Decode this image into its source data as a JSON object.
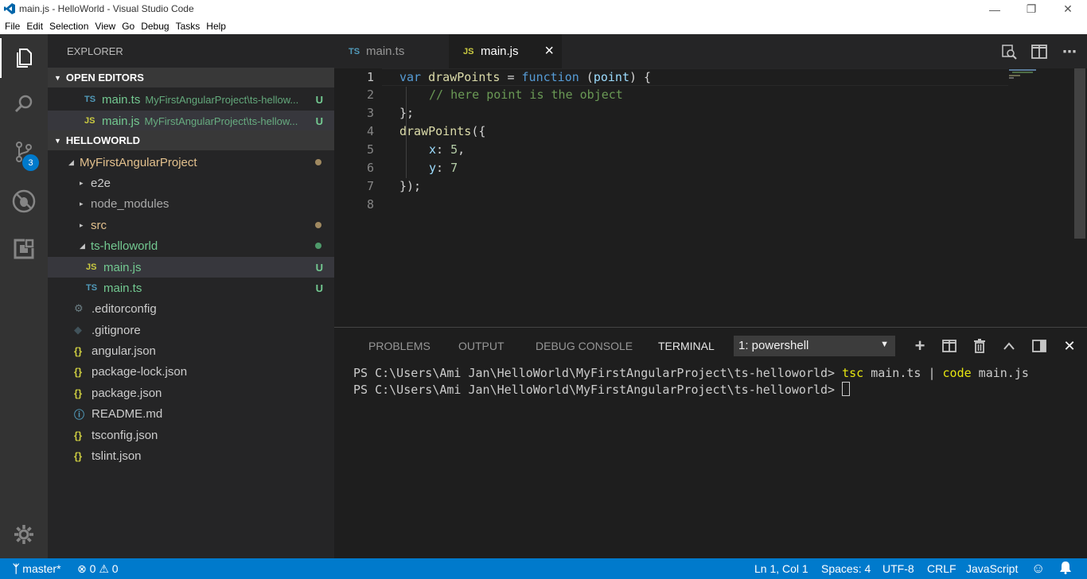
{
  "window": {
    "title": "main.js - HelloWorld - Visual Studio Code"
  },
  "menu": [
    "File",
    "Edit",
    "Selection",
    "View",
    "Go",
    "Debug",
    "Tasks",
    "Help"
  ],
  "activity": {
    "scm_badge": "3"
  },
  "sidebar": {
    "title": "EXPLORER",
    "open_editors": {
      "header": "OPEN EDITORS",
      "items": [
        {
          "icon": "TS",
          "name": "main.ts",
          "desc": "MyFirstAngularProject\\ts-hellow...",
          "status": "U"
        },
        {
          "icon": "JS",
          "name": "main.js",
          "desc": "MyFirstAngularProject\\ts-hellow...",
          "status": "U"
        }
      ]
    },
    "workspace": {
      "header": "HELLOWORLD",
      "project": "MyFirstAngularProject",
      "folders": [
        "e2e",
        "node_modules",
        "src",
        "ts-helloworld"
      ],
      "ts_helloworld_files": [
        {
          "icon": "JS",
          "name": "main.js",
          "status": "U"
        },
        {
          "icon": "TS",
          "name": "main.ts",
          "status": "U"
        }
      ],
      "root_files": [
        ".editorconfig",
        ".gitignore",
        "angular.json",
        "package-lock.json",
        "package.json",
        "README.md",
        "tsconfig.json",
        "tslint.json"
      ]
    }
  },
  "tabs": [
    {
      "icon": "TS",
      "label": "main.ts"
    },
    {
      "icon": "JS",
      "label": "main.js",
      "close": "×"
    }
  ],
  "editor": {
    "line_numbers": [
      "1",
      "2",
      "3",
      "4",
      "5",
      "6",
      "7",
      "8"
    ],
    "l1": {
      "kw": "var",
      "name": "drawPoints",
      "eq": " = ",
      "fn": "function",
      "open": " (",
      "param": "point",
      "close": ") {"
    },
    "l2": "// here point is the object",
    "l3": "};",
    "l4": {
      "fn": "drawPoints",
      "rest": "({"
    },
    "l5": {
      "key": "x",
      "colon": ": ",
      "num": "5",
      "end": ","
    },
    "l6": {
      "key": "y",
      "colon": ": ",
      "num": "7"
    },
    "l7": "});"
  },
  "panel": {
    "tabs": [
      "PROBLEMS",
      "OUTPUT",
      "DEBUG CONSOLE",
      "TERMINAL"
    ],
    "terminal_select": "1: powershell",
    "terminal_lines": {
      "l1_prompt": "PS C:\\Users\\Ami Jan\\HelloWorld\\MyFirstAngularProject\\ts-helloworld> ",
      "l1_cmd1": "tsc",
      "l1_arg1": " main.ts | ",
      "l1_cmd2": "code",
      "l1_arg2": " main.js",
      "l2_prompt": "PS C:\\Users\\Ami Jan\\HelloWorld\\MyFirstAngularProject\\ts-helloworld> "
    }
  },
  "status": {
    "branch": "master*",
    "errors": "0",
    "warnings": "0",
    "position": "Ln 1, Col 1",
    "spaces": "Spaces: 4",
    "encoding": "UTF-8",
    "eol": "CRLF",
    "language": "JavaScript"
  },
  "colors": {
    "accent": "#007acc",
    "activity_bar": "#333333",
    "sidebar": "#252526",
    "editor": "#1e1e1e",
    "untracked": "#73c991",
    "modified": "#e2c08d"
  }
}
